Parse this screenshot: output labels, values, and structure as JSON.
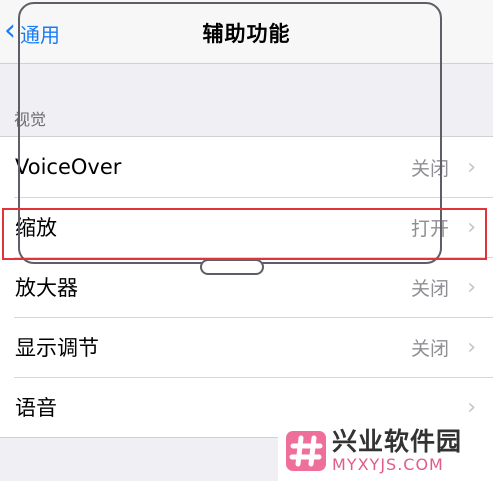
{
  "nav": {
    "back_label": "通用",
    "title": "辅助功能"
  },
  "section": {
    "header": "视觉",
    "rows": [
      {
        "label": "VoiceOver",
        "value": "关闭"
      },
      {
        "label": "缩放",
        "value": "打开"
      },
      {
        "label": "放大器",
        "value": "关闭"
      },
      {
        "label": "显示调节",
        "value": "关闭"
      },
      {
        "label": "语音",
        "value": ""
      }
    ]
  },
  "icons": {
    "back": "chevron-left-icon",
    "disclosure": "chevron-right-icon"
  },
  "watermark": {
    "brand_cn": "兴业软件园",
    "brand_en": "MYXYJS.COM"
  },
  "colors": {
    "accent": "#1a7cf5",
    "highlight": "#e0343a",
    "watermark_pink": "#e35b86"
  }
}
